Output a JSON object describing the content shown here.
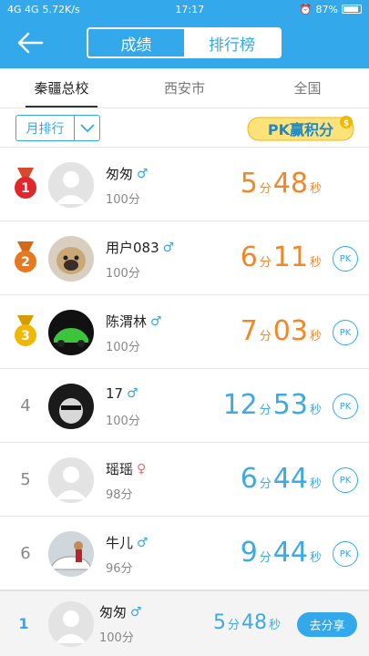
{
  "status_bar": {
    "network": "4G 4G",
    "speed": "5.72K/s",
    "time": "17:17",
    "battery": "87%"
  },
  "header": {
    "segments": [
      "成绩",
      "排行榜"
    ],
    "active_segment": "排行榜"
  },
  "tabs": [
    {
      "label": "秦疆总校",
      "active": true
    },
    {
      "label": "西安市",
      "active": false
    },
    {
      "label": "全国",
      "active": false
    }
  ],
  "filter": {
    "dropdown_label": "月排行",
    "pk_badge": "PK赢积分"
  },
  "rows": [
    {
      "rank": "1",
      "name": "匆匆",
      "gender": "♂",
      "score": "100分",
      "min": "5",
      "min_unit": "分",
      "sec": "48",
      "sec_unit": "秒",
      "has_pk": false
    },
    {
      "rank": "2",
      "name": "用户083",
      "gender": "♂",
      "score": "100分",
      "min": "6",
      "min_unit": "分",
      "sec": "11",
      "sec_unit": "秒",
      "has_pk": true
    },
    {
      "rank": "3",
      "name": "陈渭林",
      "gender": "♂",
      "score": "100分",
      "min": "7",
      "min_unit": "分",
      "sec": "03",
      "sec_unit": "秒",
      "has_pk": true
    },
    {
      "rank": "4",
      "name": "17",
      "gender": "♂",
      "score": "100分",
      "min": "12",
      "min_unit": "分",
      "sec": "53",
      "sec_unit": "秒",
      "has_pk": true
    },
    {
      "rank": "5",
      "name": "瑶瑶",
      "gender": "♀",
      "score": "98分",
      "min": "6",
      "min_unit": "分",
      "sec": "44",
      "sec_unit": "秒",
      "has_pk": true
    },
    {
      "rank": "6",
      "name": "牛儿",
      "gender": "♂",
      "score": "96分",
      "min": "9",
      "min_unit": "分",
      "sec": "44",
      "sec_unit": "秒",
      "has_pk": true
    }
  ],
  "pk_label": "PK",
  "footer": {
    "rank": "1",
    "name": "匆匆",
    "gender": "♂",
    "score": "100分",
    "min": "5",
    "min_unit": "分",
    "sec": "48",
    "sec_unit": "秒",
    "share_label": "去分享"
  },
  "colors": {
    "accent": "#33a8ea",
    "orange": "#f0882a",
    "blue": "#3fa9e2",
    "gold": "#f2b705",
    "red": "#e0272b",
    "bronze": "#e8781f"
  }
}
